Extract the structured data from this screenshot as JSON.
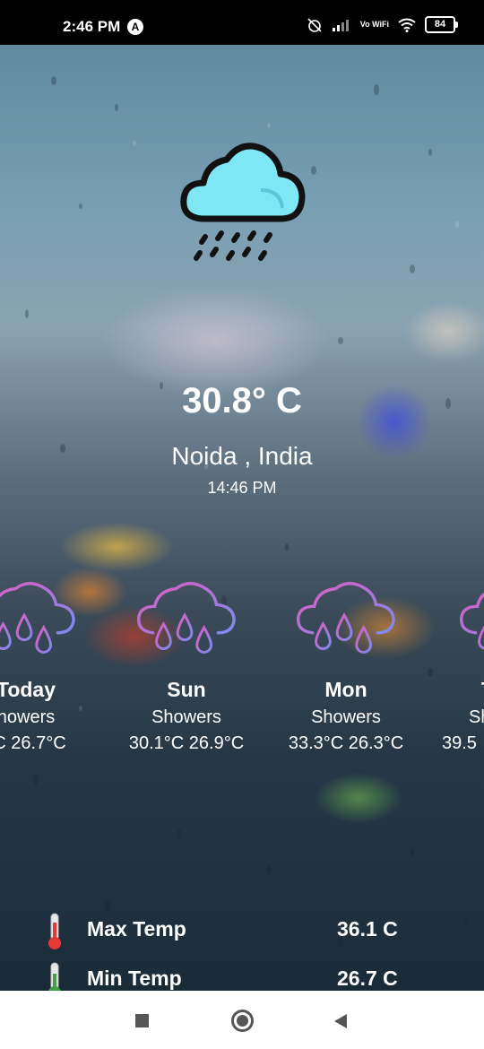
{
  "status_bar": {
    "time": "2:46 PM",
    "notification_icon": "a-circle-icon",
    "network_label": "Vo WiFi",
    "battery": "84"
  },
  "current": {
    "icon": "rain-cloud-icon",
    "temperature": "30.8° C",
    "location": "Noida , India",
    "time": "14:46 PM"
  },
  "forecast": [
    {
      "day": "Today",
      "condition": "howers",
      "temps": "°C  26.7°C"
    },
    {
      "day": "Sun",
      "condition": "Showers",
      "temps": "30.1°C  26.9°C"
    },
    {
      "day": "Mon",
      "condition": "Showers",
      "temps": "33.3°C  26.3°C"
    },
    {
      "day": "T",
      "condition": "Sh",
      "temps": "39.5"
    }
  ],
  "details": [
    {
      "label": "Max Temp",
      "value": "36.1 C",
      "icon": "thermometer-hot-icon",
      "color": "#e53935"
    },
    {
      "label": "Min Temp",
      "value": "26.7 C",
      "icon": "thermometer-cold-icon",
      "color": "#43a047"
    }
  ],
  "colors": {
    "cloud_fill": "#7fe6f5",
    "forecast_icon_gradient": [
      "#e25cc0",
      "#7a8cf0"
    ]
  }
}
